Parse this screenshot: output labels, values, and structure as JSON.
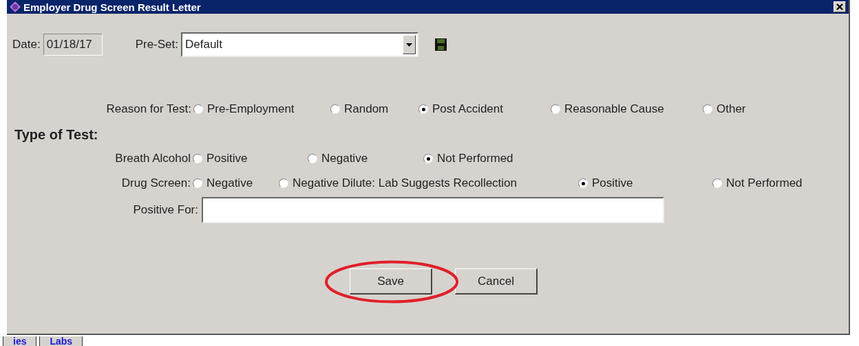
{
  "window": {
    "title": "Employer Drug Screen Result Letter"
  },
  "date": {
    "label": "Date:",
    "value": "01/18/17"
  },
  "preset": {
    "label": "Pre-Set:",
    "value": "Default"
  },
  "reason": {
    "label": "Reason for Test:",
    "options": [
      {
        "label": "Pre-Employment",
        "selected": false
      },
      {
        "label": "Random",
        "selected": false
      },
      {
        "label": "Post Accident",
        "selected": true
      },
      {
        "label": "Reasonable Cause",
        "selected": false
      },
      {
        "label": "Other",
        "selected": false
      }
    ]
  },
  "type_heading": "Type of Test:",
  "tests": [
    {
      "label": "Breath Alcohol",
      "options": [
        {
          "label": "Positive",
          "selected": false
        },
        {
          "label": "Negative",
          "selected": false
        },
        {
          "label": "Not Performed",
          "selected": true
        }
      ]
    },
    {
      "label": "Drug Screen:",
      "options": [
        {
          "label": "Negative",
          "selected": false
        },
        {
          "label": "Negative Dilute: Lab Suggests Recollection",
          "selected": false
        },
        {
          "label": "Positive",
          "selected": true
        },
        {
          "label": "Not Performed",
          "selected": false
        }
      ]
    }
  ],
  "positive_for": {
    "label": "Positive For:"
  },
  "buttons": [
    {
      "label": "Save",
      "highlighted": true
    },
    {
      "label": "Cancel",
      "highlighted": false
    }
  ],
  "background_tabs": [
    "ies",
    "Labs"
  ]
}
